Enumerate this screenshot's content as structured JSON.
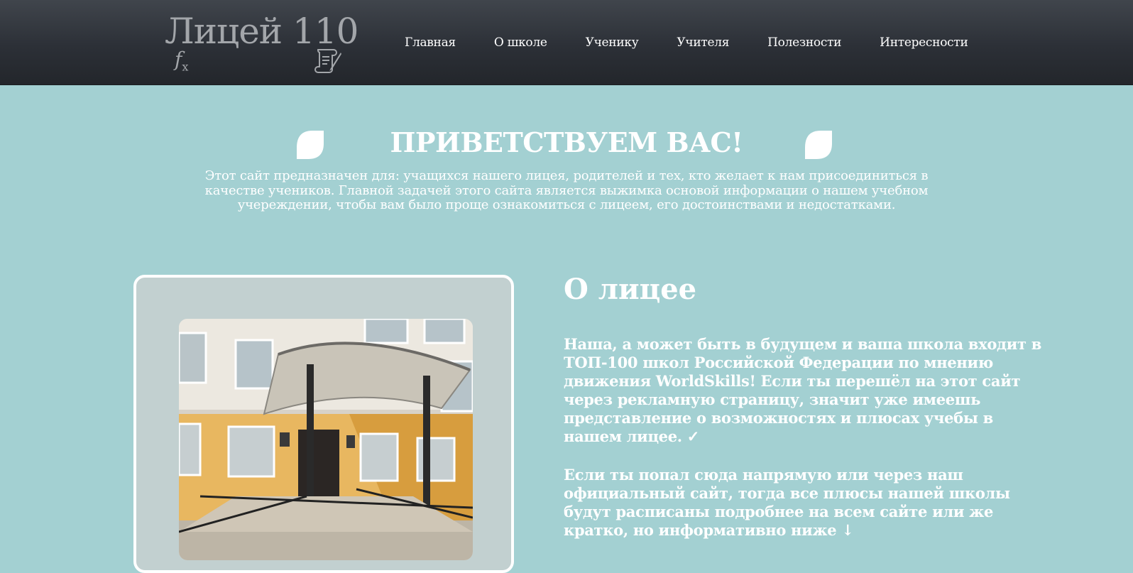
{
  "header": {
    "logo_text": "Лицей 110",
    "logo_fx": "f",
    "logo_fx_sub": "x",
    "nav": [
      {
        "label": "Главная"
      },
      {
        "label": "О школе"
      },
      {
        "label": "Ученику"
      },
      {
        "label": "Учителя"
      },
      {
        "label": "Полезности"
      },
      {
        "label": "Интересности"
      }
    ]
  },
  "welcome": {
    "title": "ПРИВЕТСТВУЕМ ВАС!",
    "text": "Этот сайт предназначен для: учащихся нашего лицея, родителей и тех, кто желает к нам присоединиться в качестве учеников. Главной задачей этого сайта является выжимка основой информации о нашем учебном учереждении, чтобы вам было проще ознакомиться с лицеем, его достоинствами и недостатками."
  },
  "about": {
    "title": "О лицее",
    "paragraph1": "Наша, а может быть в будущем и ваша школа входит в ТОП-100 школ Российской Федерации по мнению движения WorldSkills! Если ты перешёл на этот сайт через рекламную страницу, значит уже имеешь представление о возможностях и плюсах учебы в нашем лицее. ✓",
    "paragraph2": "Если ты попал сюда напрямую или через наш официальный сайт, тогда все плюсы нашей школы будут расписаны подробнее на всем сайте или же кратко, но информативно ниже ↓"
  },
  "icons": {
    "logo_scroll": "scroll-quill-icon",
    "welcome_left": "leaf-icon",
    "welcome_right": "leaf-icon"
  },
  "colors": {
    "header_bg": "#2c3037",
    "page_bg": "#a3d0d2",
    "card_bg": "#c2d0d0",
    "text": "#ffffff",
    "logo_text": "#a3a6aa"
  }
}
